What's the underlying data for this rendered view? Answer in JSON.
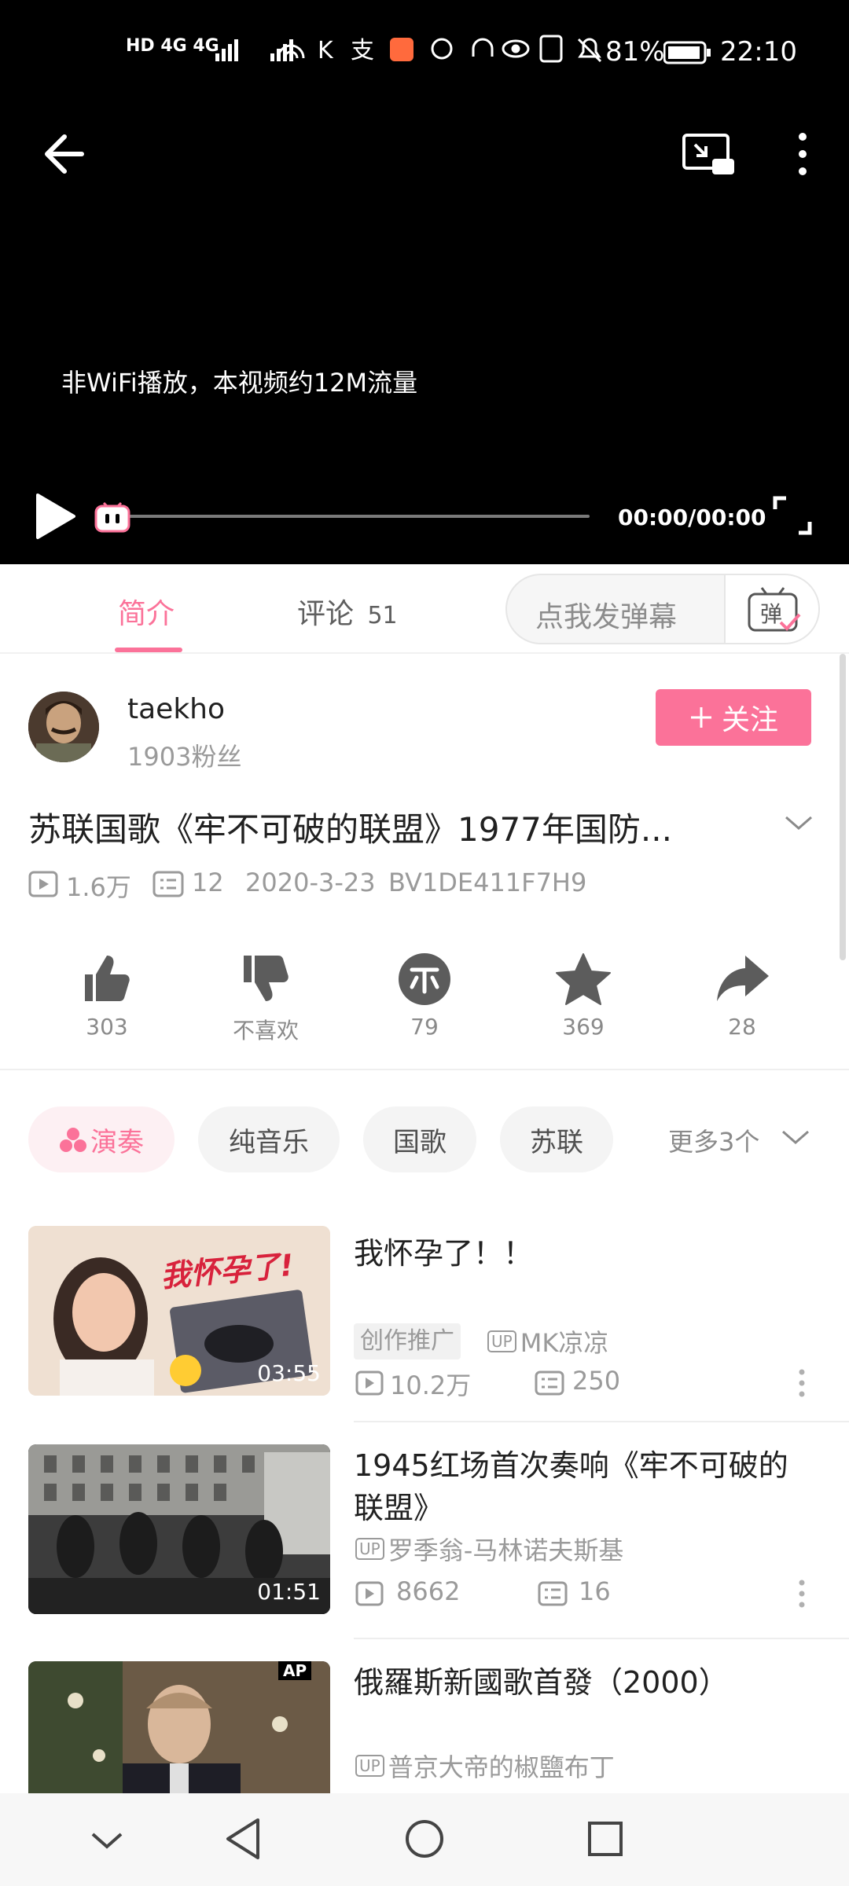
{
  "status_bar": {
    "left_indicators": "HD 4G 4G",
    "battery": "81%",
    "time": "22:10"
  },
  "player": {
    "notice": "非WiFi播放，本视频约12M流量",
    "time": "00:00/00:00"
  },
  "tabs": {
    "intro": "简介",
    "comments_label": "评论",
    "comments_count": "51",
    "danmaku_placeholder": "点我发弹幕",
    "danmaku_button": "弹"
  },
  "uploader": {
    "name": "taekho",
    "fans": "1903粉丝",
    "follow": "关注"
  },
  "video": {
    "title": "苏联国歌《牢不可破的联盟》1977年国防...",
    "views": "1.6万",
    "danmakus": "12",
    "date": "2020-3-23",
    "bvid": "BV1DE411F7H9"
  },
  "actions": {
    "like": "303",
    "dislike": "不喜欢",
    "coin": "79",
    "favorite": "369",
    "share": "28"
  },
  "tags": {
    "items": [
      "演奏",
      "纯音乐",
      "国歌",
      "苏联"
    ],
    "more": "更多3个"
  },
  "recommendations": [
    {
      "title": "我怀孕了！！",
      "badge": "创作推广",
      "up_prefix": "UP",
      "up": "MK凉凉",
      "views": "10.2万",
      "danmakus": "250",
      "duration": "03:55",
      "thumb_text": "我怀孕了!"
    },
    {
      "title": "1945红场首次奏响《牢不可破的联盟》",
      "up_prefix": "UP",
      "up": "罗季翁-马林诺夫斯基",
      "views": "8662",
      "danmakus": "16",
      "duration": "01:51"
    },
    {
      "title": "俄羅斯新國歌首發（2000）",
      "up_prefix": "UP",
      "up": "普京大帝的椒鹽布丁",
      "thumb_text": "AP"
    }
  ],
  "colors": {
    "accent": "#fb7299",
    "muted": "#9a9a9a"
  }
}
